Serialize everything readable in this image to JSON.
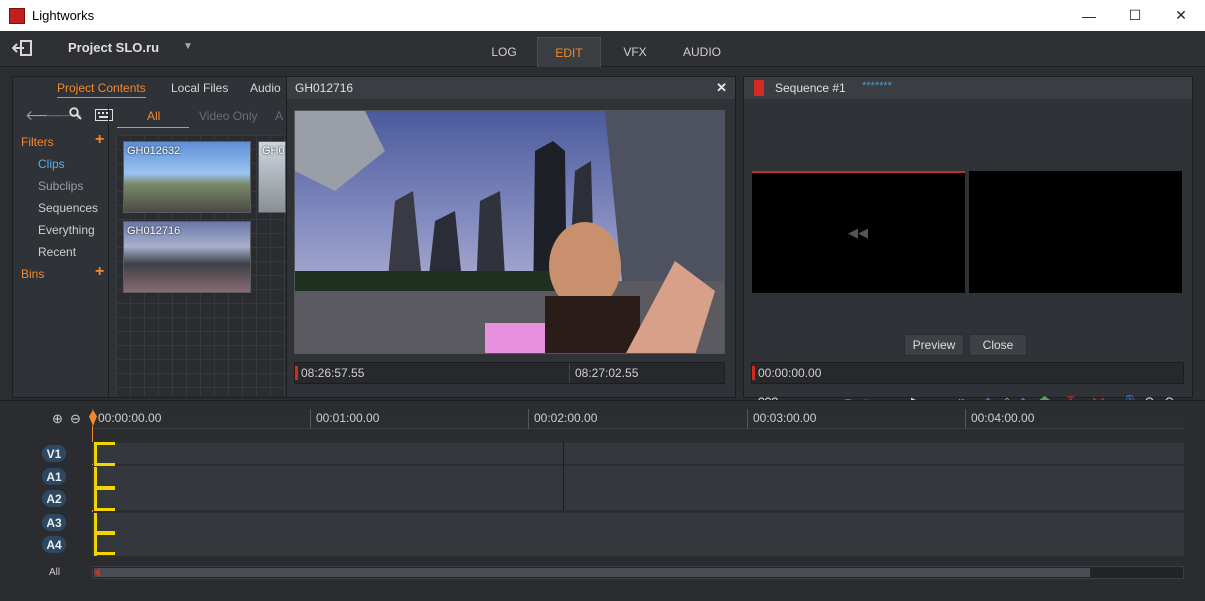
{
  "window": {
    "title": "Lightworks",
    "minimize": "—",
    "maximize": "☐",
    "close": "✕"
  },
  "menubar": {
    "project_name": "Project SLO.ru",
    "project_caret": "▼",
    "tabs": [
      {
        "label": "LOG",
        "active": false
      },
      {
        "label": "EDIT",
        "active": true
      },
      {
        "label": "VFX",
        "active": false
      },
      {
        "label": "AUDIO",
        "active": false
      }
    ]
  },
  "project_panel": {
    "tabs": [
      "Project Contents",
      "Local Files",
      "Audio"
    ],
    "filters_label": "Filters",
    "bins_label": "Bins",
    "add_symbol": "+",
    "sidebar_items": [
      "Clips",
      "Subclips",
      "Sequences",
      "Everything",
      "Recent"
    ],
    "subtabs": [
      "All",
      "Video Only",
      "A"
    ],
    "clips": [
      "GH012632",
      "GH0",
      "GH012716"
    ]
  },
  "source_viewer": {
    "title": "GH012716",
    "close_symbol": "✕",
    "timecode_in": "08:26:57.55",
    "timecode_out": "08:27:02.55"
  },
  "sequence_panel": {
    "title": "Sequence #1",
    "dots": "*******",
    "rewind_symbol": "◀◀",
    "preview_label": "Preview",
    "close_label": "Close",
    "timecode": "00:00:00.00",
    "speed": "???"
  },
  "timeline": {
    "ruler_labels": [
      "00:00:00.00",
      "00:01:00.00",
      "00:02:00.00",
      "00:03:00.00",
      "00:04:00.00"
    ],
    "tracks": [
      "V1",
      "A1",
      "A2",
      "A3",
      "A4"
    ],
    "all_label": "All"
  },
  "colors": {
    "accent_orange": "#f08a2c",
    "selected_blue": "#5aaee8",
    "record_red": "#d42a22",
    "track_yellow": "#f2d500"
  }
}
